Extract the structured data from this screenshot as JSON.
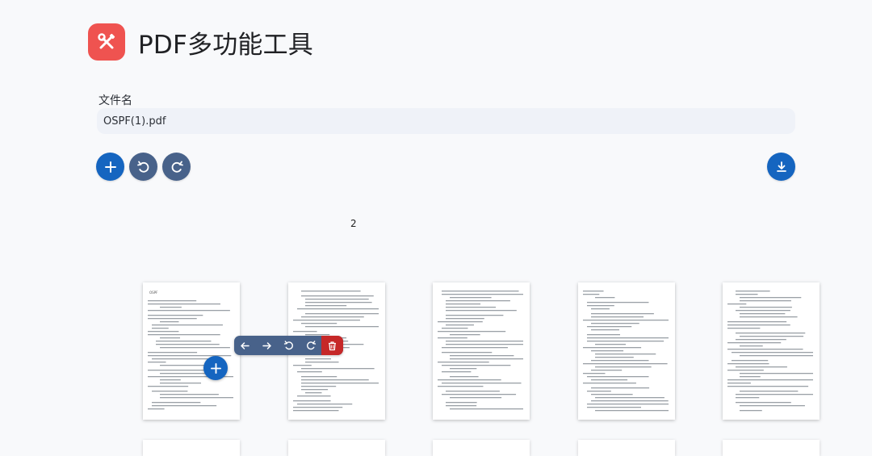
{
  "app": {
    "title": "PDF多功能工具",
    "logo_icon": "tools-icon",
    "accent": "#ef5350"
  },
  "file": {
    "label": "文件名",
    "value": "OSPF(1).pdf"
  },
  "toolbar": {
    "add_icon": "plus-icon",
    "rotate_left_icon": "rotate-left-icon",
    "rotate_right_icon": "rotate-right-icon",
    "download_icon": "download-icon",
    "primary_color": "#1565c0",
    "secondary_color": "#48628a"
  },
  "document": {
    "page_count": "2"
  },
  "page_toolbar": {
    "items": [
      "arrow-left-icon",
      "arrow-right-icon",
      "rotate-left-icon",
      "rotate-right-icon",
      "trash-icon"
    ],
    "delete_color": "#c62828"
  },
  "page_insert_icon": "plus-icon",
  "page_title_text": "OSPF"
}
